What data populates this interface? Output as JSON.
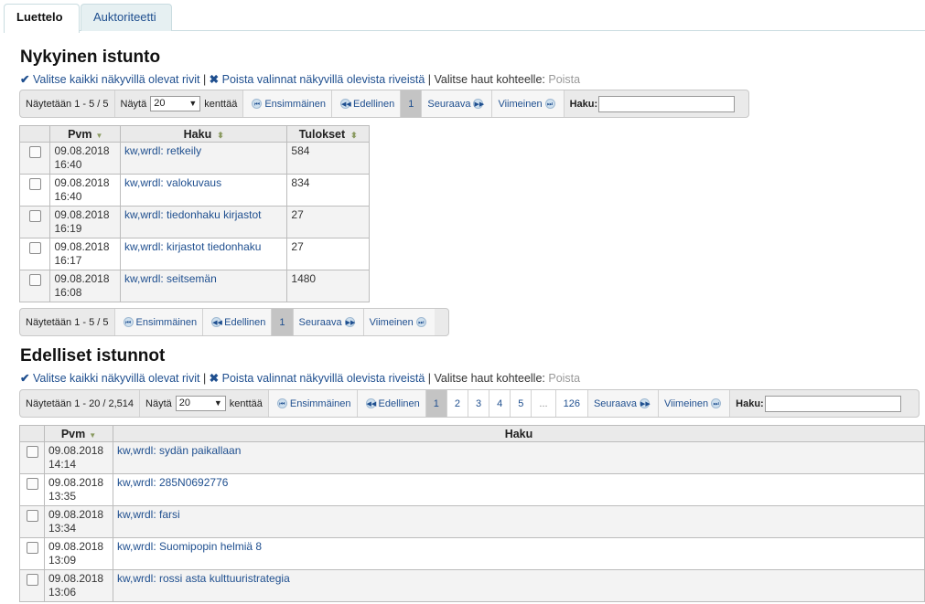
{
  "tabs": [
    "Luettelo",
    "Auktoriteetti"
  ],
  "current": {
    "heading": "Nykyinen istunto",
    "select_all": "Valitse kaikki näkyvillä olevat rivit",
    "deselect": "Poista valinnat näkyvillä olevista riveistä",
    "choose_label": "Valitse haut kohteelle:",
    "delete_label": "Poista",
    "top_pager": {
      "info": "Näytetään 1 - 5 / 5",
      "show_label": "Näytä",
      "show_value": "20",
      "fields_label": "kenttää",
      "first": "Ensimmäinen",
      "previous": "Edellinen",
      "page": "1",
      "next": "Seuraava",
      "last": "Viimeinen",
      "search_label": "Haku:"
    },
    "bottom_pager": {
      "info": "Näytetään 1 - 5 / 5",
      "first": "Ensimmäinen",
      "previous": "Edellinen",
      "page": "1",
      "next": "Seuraava",
      "last": "Viimeinen"
    },
    "columns": [
      "Pvm",
      "Haku",
      "Tulokset"
    ],
    "rows": [
      {
        "date": "09.08.2018",
        "time": "16:40",
        "query": "kw,wrdl: retkeily",
        "results": "584"
      },
      {
        "date": "09.08.2018",
        "time": "16:40",
        "query": "kw,wrdl: valokuvaus",
        "results": "834"
      },
      {
        "date": "09.08.2018",
        "time": "16:19",
        "query": "kw,wrdl: tiedonhaku kirjastot",
        "results": "27"
      },
      {
        "date": "09.08.2018",
        "time": "16:17",
        "query": "kw,wrdl: kirjastot tiedonhaku",
        "results": "27"
      },
      {
        "date": "09.08.2018",
        "time": "16:08",
        "query": "kw,wrdl: seitsemän",
        "results": "1480"
      }
    ]
  },
  "previous": {
    "heading": "Edelliset istunnot",
    "select_all": "Valitse kaikki näkyvillä olevat rivit",
    "deselect": "Poista valinnat näkyvillä olevista riveistä",
    "choose_label": "Valitse haut kohteelle:",
    "delete_label": "Poista",
    "pager": {
      "info": "Näytetään 1 - 20 / 2,514",
      "show_label": "Näytä",
      "show_value": "20",
      "fields_label": "kenttää",
      "first": "Ensimmäinen",
      "previous": "Edellinen",
      "pages": [
        "1",
        "2",
        "3",
        "4",
        "5",
        "...",
        "126"
      ],
      "next": "Seuraava",
      "last": "Viimeinen",
      "search_label": "Haku:"
    },
    "columns": [
      "Pvm",
      "Haku"
    ],
    "rows": [
      {
        "date": "09.08.2018",
        "time": "14:14",
        "query": "kw,wrdl: sydän paikallaan"
      },
      {
        "date": "09.08.2018",
        "time": "13:35",
        "query": "kw,wrdl: 285N0692776"
      },
      {
        "date": "09.08.2018",
        "time": "13:34",
        "query": "kw,wrdl: farsi"
      },
      {
        "date": "09.08.2018",
        "time": "13:09",
        "query": "kw,wrdl: Suomipopin helmiä 8"
      },
      {
        "date": "09.08.2018",
        "time": "13:06",
        "query": "kw,wrdl: rossi asta kulttuuristrategia"
      }
    ]
  }
}
